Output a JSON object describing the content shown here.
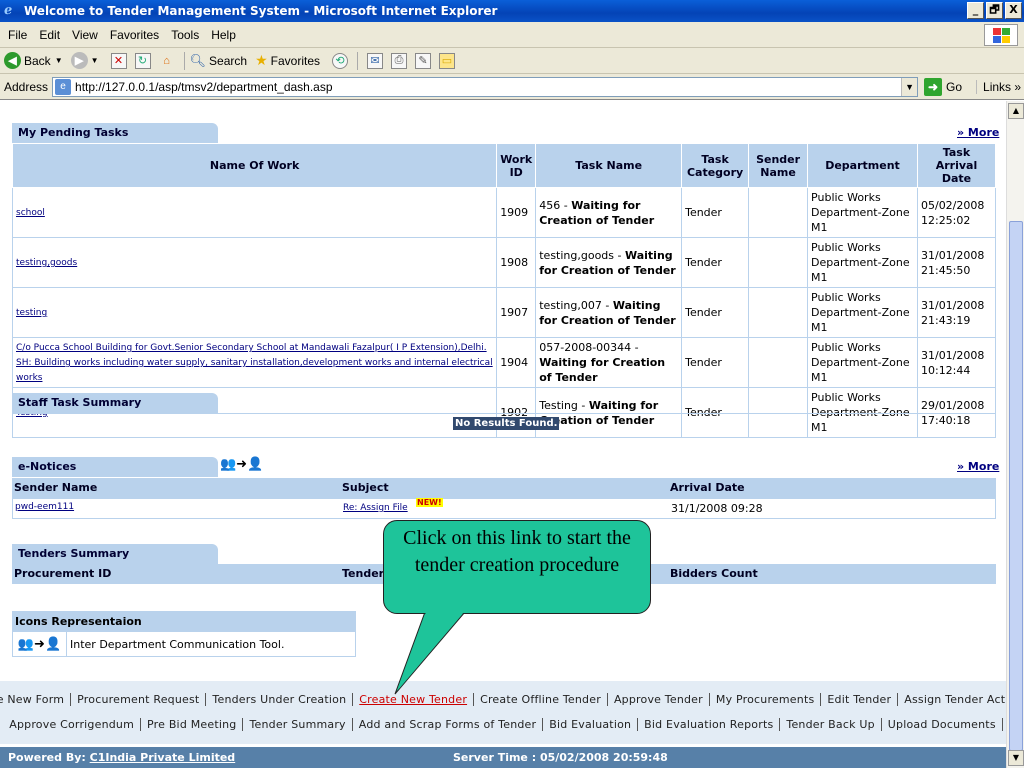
{
  "window": {
    "title": "Welcome to Tender Management System - Microsoft Internet Explorer",
    "controls": [
      "_",
      "🗗",
      "X"
    ]
  },
  "menu": [
    "File",
    "Edit",
    "View",
    "Favorites",
    "Tools",
    "Help"
  ],
  "toolbar": {
    "back": "Back",
    "search": "Search",
    "favorites": "Favorites"
  },
  "address": {
    "label": "Address",
    "url": "http://127.0.0.1/asp/tmsv2/department_dash.asp",
    "go": "Go",
    "links": "Links"
  },
  "pending": {
    "title": "My Pending Tasks",
    "more": "» More",
    "headers": [
      "Name Of Work",
      "Work ID",
      "Task Name",
      "Task Category",
      "Sender Name",
      "Department",
      "Task Arrival Date"
    ],
    "rows": [
      {
        "name": "school",
        "id": "1909",
        "task_prefix": "456 - ",
        "task_bold": "Waiting for Creation of Tender",
        "category": "Tender",
        "sender": "",
        "dept": "Public Works Department-Zone M1",
        "date": "05/02/2008 12:25:02"
      },
      {
        "name": "testing,goods",
        "id": "1908",
        "task_prefix": "testing,goods - ",
        "task_bold": "Waiting for Creation of Tender",
        "category": "Tender",
        "sender": "",
        "dept": "Public Works Department-Zone M1",
        "date": "31/01/2008 21:45:50"
      },
      {
        "name": "testing",
        "id": "1907",
        "task_prefix": "testing,007 - ",
        "task_bold": "Waiting for Creation of Tender",
        "category": "Tender",
        "sender": "",
        "dept": "Public Works Department-Zone M1",
        "date": "31/01/2008 21:43:19"
      },
      {
        "name": "C/o Pucca School Building for Govt.Senior Secondary School at Mandawali Fazalpur( I P Extension),Delhi. SH: Building works including water supply, sanitary installation,development works and internal electrical works",
        "id": "1904",
        "task_prefix": "057-2008-00344 - ",
        "task_bold": "Waiting for Creation of Tender",
        "category": "Tender",
        "sender": "",
        "dept": "Public Works Department-Zone M1",
        "date": "31/01/2008 10:12:44"
      },
      {
        "name": "Testing",
        "id": "1902",
        "task_prefix": "Testing - ",
        "task_bold": "Waiting for Creation of Tender",
        "category": "Tender",
        "sender": "",
        "dept": "Public Works Department-Zone M1",
        "date": "29/01/2008 17:40:18"
      }
    ]
  },
  "staff": {
    "title": "Staff Task Summary",
    "empty": "No Results Found."
  },
  "notices": {
    "title": "e-Notices",
    "more": "» More",
    "headers": [
      "Sender Name",
      "Subject",
      "Arrival Date"
    ],
    "row": {
      "sender": "pwd-eem111",
      "subject": "Re: Assign File",
      "badge": "NEW!",
      "date": "31/1/2008 09:28"
    }
  },
  "tenders": {
    "title": "Tenders Summary",
    "headers": [
      "Procurement ID",
      "Tender",
      "Bidders Count"
    ]
  },
  "icons": {
    "title": "Icons Representaion",
    "desc": "Inter Department Communication Tool."
  },
  "nav_row1": [
    "Create New Form",
    "Procurement Request",
    "Tenders Under Creation",
    "Create New Tender",
    "Create Offline Tender",
    "Approve Tender",
    "My Procurements",
    "Edit Tender",
    "Assign Tender Activities"
  ],
  "nav_row2": [
    "Approve Corrigendum",
    "Pre Bid Meeting",
    "Tender Summary",
    "Add and Scrap Forms of Tender",
    "Bid Evaluation",
    "Bid Evaluation Reports",
    "Tender Back Up",
    "Upload Documents"
  ],
  "status": {
    "powered_label": "Powered By: ",
    "powered_name": "C1India Private Limited",
    "server_time": "Server Time : 05/02/2008 20:59:48"
  },
  "callout": "Click on this link to start the tender creation procedure"
}
